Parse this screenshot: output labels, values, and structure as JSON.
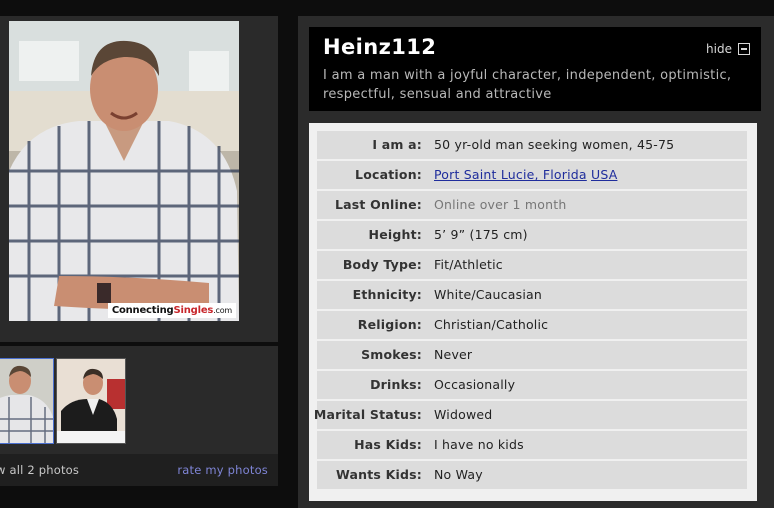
{
  "left": {
    "main_photo": {
      "watermark": {
        "part1": "Connecting",
        "part2": "Singles",
        "part3": ".com"
      }
    },
    "thumbnails": {
      "view_all": "w all 2 photos",
      "rate": "rate my photos"
    }
  },
  "profile": {
    "username": "Heinz112",
    "tagline": "I am a man with a joyful character, independent, optimistic, respectful, sensual and attractive",
    "hide_label": "hide",
    "details": [
      {
        "label": "I am a:",
        "value": "50 yr-old man seeking women, 45-75"
      },
      {
        "label": "Location:",
        "city": "Port Saint Lucie, Florida",
        "country": "USA"
      },
      {
        "label": "Last Online:",
        "value": "Online over 1 month"
      },
      {
        "label": "Height:",
        "value": "5’ 9”  (175 cm)"
      },
      {
        "label": "Body Type:",
        "value": "Fit/Athletic"
      },
      {
        "label": "Ethnicity:",
        "value": "White/Caucasian"
      },
      {
        "label": "Religion:",
        "value": "Christian/Catholic"
      },
      {
        "label": "Smokes:",
        "value": "Never"
      },
      {
        "label": "Drinks:",
        "value": "Occasionally"
      },
      {
        "label": "Marital Status:",
        "value": "Widowed"
      },
      {
        "label": "Has Kids:",
        "value": "I have no kids"
      },
      {
        "label": "Wants Kids:",
        "value": "No Way"
      }
    ]
  },
  "colors": {
    "link": "#1f2d9c",
    "rate_link": "#7f85d6",
    "row_bg": "#dcdcdc",
    "panel_bg": "#2b2b2b"
  }
}
